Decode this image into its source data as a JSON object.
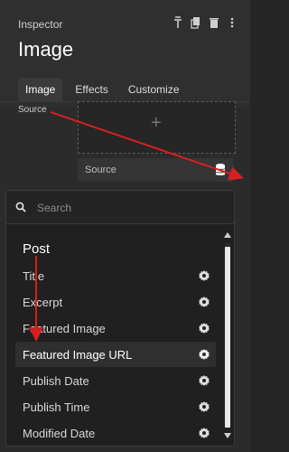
{
  "header": {
    "crumb": "Inspector",
    "title": "Image",
    "icons": [
      "pin-icon",
      "copy-icon",
      "trash-icon",
      "more-icon"
    ]
  },
  "tabs": [
    {
      "label": "Image"
    },
    {
      "label": "Effects"
    },
    {
      "label": "Customize"
    }
  ],
  "image_settings": {
    "source_label": "Source",
    "dropzone_symbol": "+",
    "source_field": "Source"
  },
  "dropdown": {
    "search_placeholder": "Search",
    "group": "Post",
    "items": [
      {
        "label": "Title"
      },
      {
        "label": "Excerpt"
      },
      {
        "label": "Featured Image"
      },
      {
        "label": "Featured Image URL",
        "selected": true
      },
      {
        "label": "Publish Date"
      },
      {
        "label": "Publish Time"
      },
      {
        "label": "Modified Date"
      }
    ]
  },
  "colors": {
    "background": "#262626",
    "annotation_arrow": "#d61f1f"
  }
}
